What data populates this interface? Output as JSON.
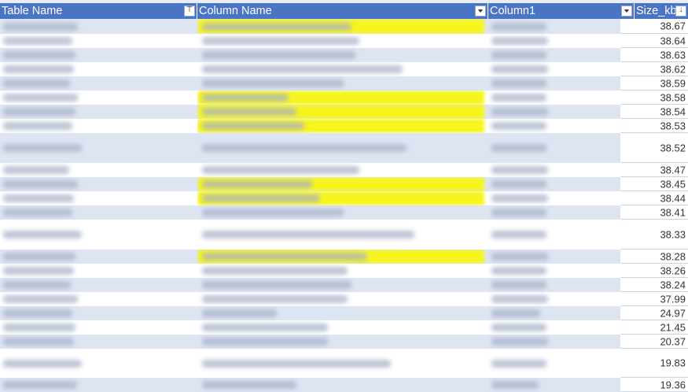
{
  "columns": [
    {
      "label": "Table Name",
      "filter": "sort-filter"
    },
    {
      "label": "Column Name",
      "filter": "dropdown"
    },
    {
      "label": "Column1",
      "filter": "dropdown"
    },
    {
      "label": "Size_kb",
      "filter": "sort-desc-filter"
    }
  ],
  "filter_glyphs": {
    "sorted": "↓",
    "sort_filter": "⊤"
  },
  "rows": [
    {
      "size": "38.67",
      "highlight": true
    },
    {
      "size": "38.64",
      "highlight": false
    },
    {
      "size": "38.63",
      "highlight": false
    },
    {
      "size": "38.62",
      "highlight": false
    },
    {
      "size": "38.59",
      "highlight": false
    },
    {
      "size": "38.58",
      "highlight": true
    },
    {
      "size": "38.54",
      "highlight": true
    },
    {
      "size": "38.53",
      "highlight": true
    },
    {
      "size": "38.52",
      "highlight": false
    },
    {
      "size": "38.47",
      "highlight": false
    },
    {
      "size": "38.45",
      "highlight": true
    },
    {
      "size": "38.44",
      "highlight": true
    },
    {
      "size": "38.41",
      "highlight": false
    },
    {
      "size": "38.33",
      "highlight": false
    },
    {
      "size": "38.28",
      "highlight": true
    },
    {
      "size": "38.26",
      "highlight": false
    },
    {
      "size": "38.24",
      "highlight": false
    },
    {
      "size": "37.99",
      "highlight": false
    },
    {
      "size": "24.97",
      "highlight": false
    },
    {
      "size": "21.45",
      "highlight": false
    },
    {
      "size": "20.37",
      "highlight": false
    },
    {
      "size": "19.83",
      "highlight": false
    },
    {
      "size": "19.36",
      "highlight": false
    }
  ],
  "colors": {
    "header": "#4a74c4",
    "band": "#dde4f2",
    "highlight": "#f6f51e"
  }
}
